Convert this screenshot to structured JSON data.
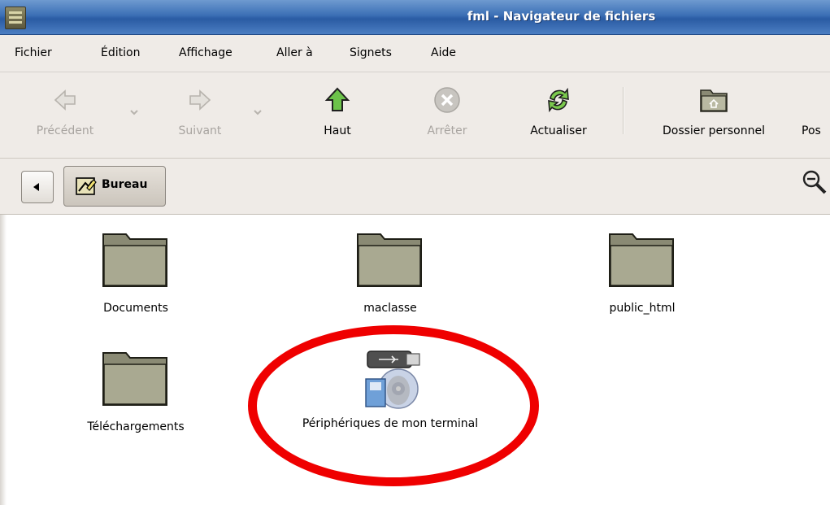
{
  "window": {
    "title": "fml - Navigateur de fichiers"
  },
  "menu": {
    "items": [
      {
        "label": "Fichier"
      },
      {
        "label": "Édition"
      },
      {
        "label": "Affichage"
      },
      {
        "label": "Aller à"
      },
      {
        "label": "Signets"
      },
      {
        "label": "Aide"
      }
    ]
  },
  "toolbar": {
    "back_label": "Précédent",
    "forward_label": "Suivant",
    "up_label": "Haut",
    "stop_label": "Arrêter",
    "reload_label": "Actualiser",
    "home_label": "Dossier personnel",
    "computer_label": "Pos"
  },
  "location": {
    "crumb_label": "Bureau"
  },
  "files": [
    {
      "name": "Documents"
    },
    {
      "name": "maclasse"
    },
    {
      "name": "public_html"
    },
    {
      "name": "Téléchargements"
    },
    {
      "name": "Périphériques de mon terminal"
    }
  ],
  "colors": {
    "title_bar": "#3b6fb5",
    "highlight": "#ef0000",
    "folder": "#8a8a74"
  }
}
